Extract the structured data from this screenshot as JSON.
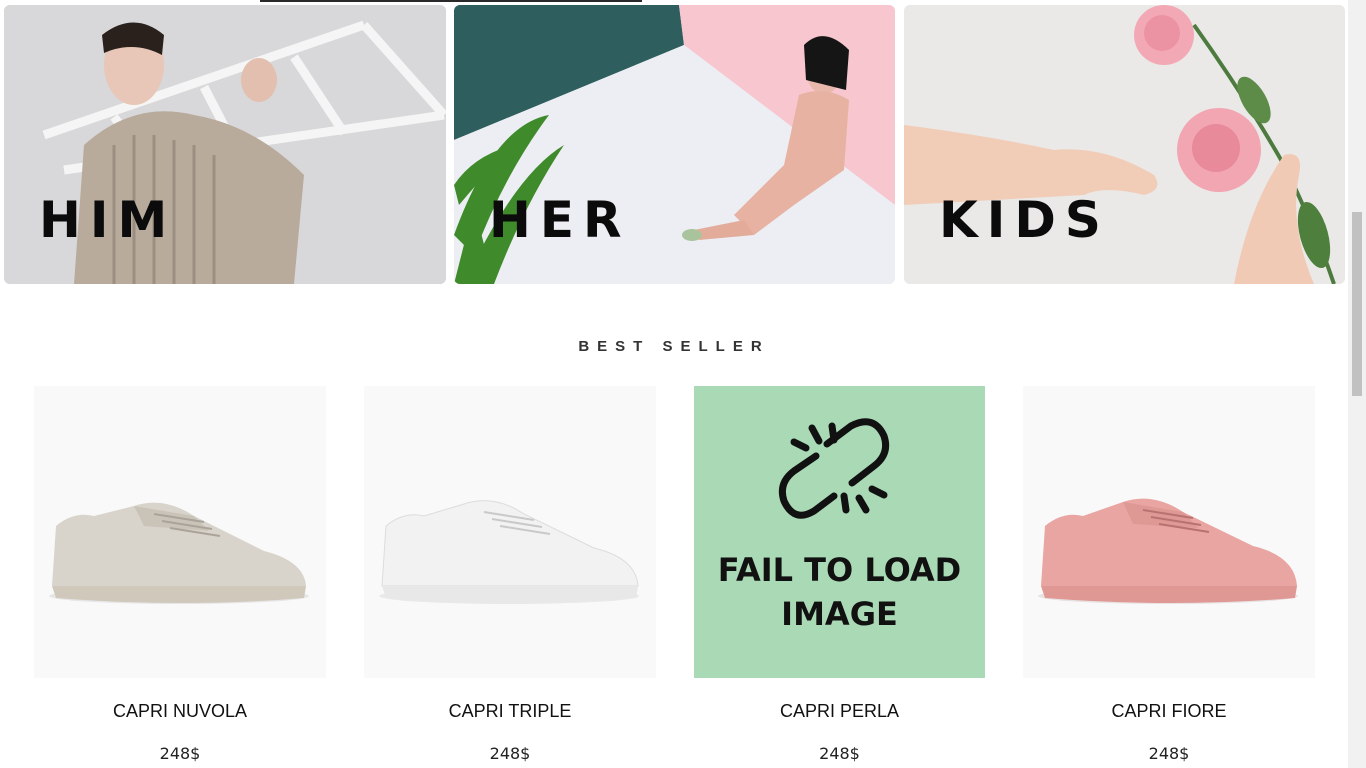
{
  "categories": [
    {
      "label": "HIM"
    },
    {
      "label": "HER"
    },
    {
      "label": "KIDS"
    }
  ],
  "section": {
    "title": "BEST SELLER"
  },
  "products": [
    {
      "name": "CAPRI NUVOLA",
      "price": "248$",
      "color": "#d8d4cb"
    },
    {
      "name": "CAPRI TRIPLE",
      "price": "248$",
      "color": "#f2f2f2"
    },
    {
      "name": "CAPRI PERLA",
      "price": "248$",
      "image_error": "FAIL TO LOAD IMAGE"
    },
    {
      "name": "CAPRI FIORE",
      "price": "248$",
      "color": "#e9a5a1"
    }
  ],
  "colors": {
    "accent_green": "#aad9b5",
    "her_teal": "#2e5e5e",
    "her_pink": "#f7c6cf"
  }
}
